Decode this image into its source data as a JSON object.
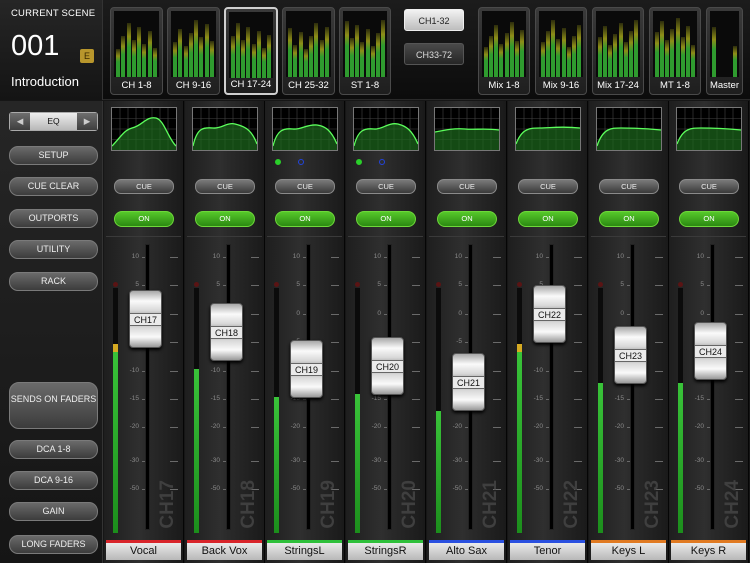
{
  "scene": {
    "caption": "CURRENT SCENE",
    "number": "001",
    "badge": "E",
    "name": "Introduction"
  },
  "banks_left": [
    {
      "label": "CH 1-8",
      "selected": false
    },
    {
      "label": "CH 9-16",
      "selected": false
    },
    {
      "label": "CH 17-24",
      "selected": true
    },
    {
      "label": "CH 25-32",
      "selected": false
    },
    {
      "label": "ST 1-8",
      "selected": false
    }
  ],
  "channel_mode": [
    {
      "label": "CH1-32",
      "active": true
    },
    {
      "label": "CH33-72",
      "active": false
    }
  ],
  "banks_right": [
    {
      "label": "Mix 1-8"
    },
    {
      "label": "Mix 9-16"
    },
    {
      "label": "Mix 17-24"
    },
    {
      "label": "MT 1-8"
    },
    {
      "label": "Master"
    }
  ],
  "sidebar": {
    "selector": {
      "prev": "◀",
      "label": "EQ",
      "next": "▶"
    },
    "buttons": [
      "SETUP",
      "CUE CLEAR",
      "OUTPORTS",
      "UTILITY",
      "RACK"
    ],
    "sends": "SENDS ON FADERS",
    "lower": [
      "DCA 1-8",
      "DCA 9-16",
      "GAIN",
      "LONG FADERS"
    ]
  },
  "scale": [
    "10",
    "5",
    "0",
    "-5",
    "-10",
    "-15",
    "-20",
    "-30",
    "-50"
  ],
  "channels": [
    {
      "id": "CH17",
      "name": "Vocal",
      "color": "#d8242a",
      "fader": 0.8,
      "meter": 0.77,
      "yellow": true,
      "dots": []
    },
    {
      "id": "CH18",
      "name": "Back Vox",
      "color": "#d8242a",
      "fader": 0.74,
      "meter": 0.7,
      "yellow": false,
      "dots": []
    },
    {
      "id": "CH19",
      "name": "StringsL",
      "color": "#2ec03a",
      "fader": 0.58,
      "meter": 0.58,
      "yellow": false,
      "dots": [
        "#2ad02a",
        "#2244dd"
      ]
    },
    {
      "id": "CH20",
      "name": "StringsR",
      "color": "#2ec03a",
      "fader": 0.59,
      "meter": 0.59,
      "yellow": false,
      "dots": [
        "#2ad02a",
        "#2244dd"
      ]
    },
    {
      "id": "CH21",
      "name": "Alto Sax",
      "color": "#2a50e0",
      "fader": 0.52,
      "meter": 0.52,
      "yellow": false,
      "dots": []
    },
    {
      "id": "CH22",
      "name": "Tenor",
      "color": "#2a50e0",
      "fader": 0.82,
      "meter": 0.77,
      "yellow": true,
      "dots": []
    },
    {
      "id": "CH23",
      "name": "Keys L",
      "color": "#e07a22",
      "fader": 0.64,
      "meter": 0.64,
      "yellow": false,
      "dots": []
    },
    {
      "id": "CH24",
      "name": "Keys R",
      "color": "#e07a22",
      "fader": 0.66,
      "meter": 0.64,
      "yellow": false,
      "dots": []
    }
  ],
  "labels": {
    "cue": "CUE",
    "on": "ON"
  }
}
